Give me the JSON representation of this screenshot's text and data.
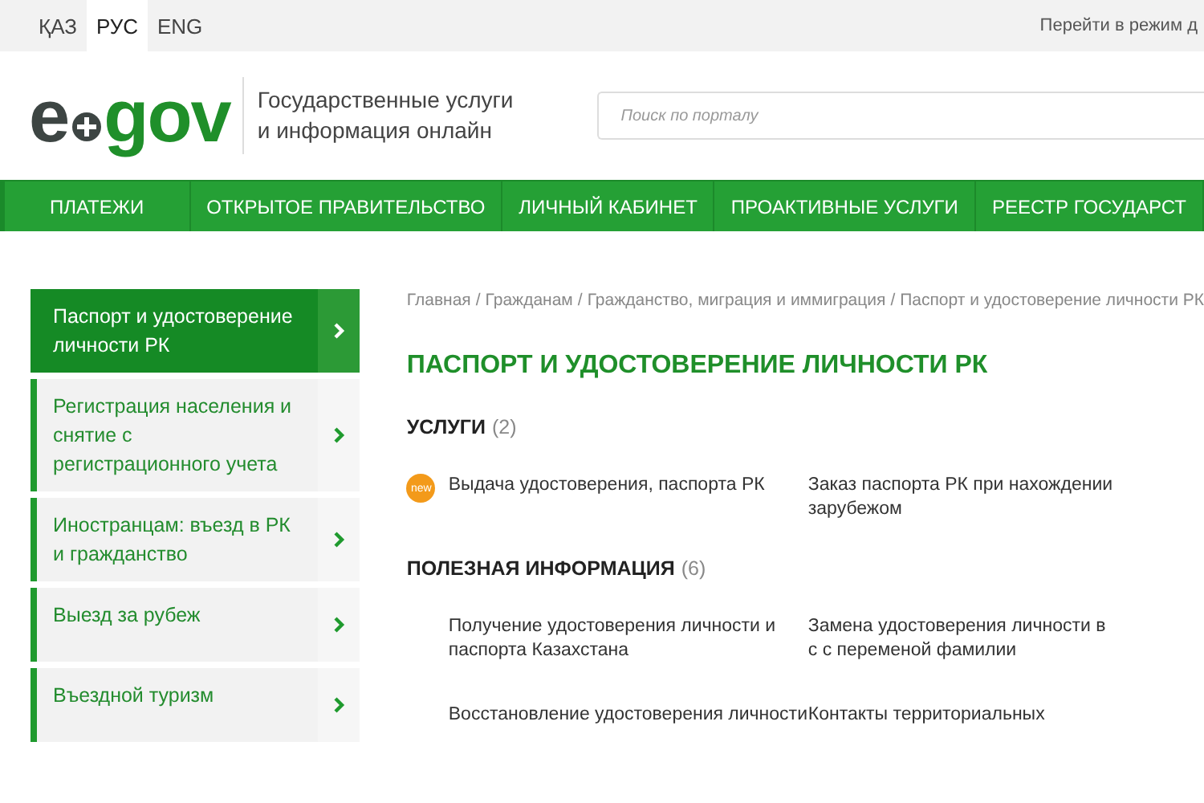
{
  "top_bar": {
    "languages": [
      {
        "label": "ҚАЗ",
        "selected": false
      },
      {
        "label": "РУС",
        "selected": true
      },
      {
        "label": "ENG",
        "selected": false
      }
    ],
    "right_link": "Перейти в режим д"
  },
  "header": {
    "logo": {
      "left": "e",
      "right": "gov"
    },
    "tagline": [
      "Государственные услуги",
      "и информация онлайн"
    ],
    "search": {
      "placeholder": "Поиск по порталу"
    }
  },
  "nav": [
    "ПЛАТЕЖИ",
    "ОТКРЫТОЕ ПРАВИТЕЛЬСТВО",
    "ЛИЧНЫЙ КАБИНЕТ",
    "ПРОАКТИВНЫЕ УСЛУГИ",
    "РЕЕСТР ГОСУДАРСТ"
  ],
  "sidebar": {
    "items": [
      {
        "label": "Паспорт и удостоверение личности РК",
        "selected": true
      },
      {
        "label": "Регистрация населения и снятие с регистрационного учета",
        "selected": false
      },
      {
        "label": "Иностранцам: въезд в РК и гражданство",
        "selected": false
      },
      {
        "label": "Выезд за рубеж",
        "selected": false
      },
      {
        "label": "Въездной туризм",
        "selected": false
      }
    ]
  },
  "breadcrumbs": [
    {
      "kind": "link",
      "text": "Главная"
    },
    {
      "kind": "separator",
      "text": "/"
    },
    {
      "kind": "link",
      "text": "Гражданам"
    },
    {
      "kind": "separator",
      "text": "/"
    },
    {
      "kind": "link",
      "text": "Гражданство, миграция и иммиграция"
    },
    {
      "kind": "separator",
      "text": "/"
    },
    {
      "kind": "link",
      "text": "Паспорт и удостоверение личности РК"
    }
  ],
  "title": "ПАСПОРТ И УДОСТОВЕРЕНИЕ ЛИЧНОСТИ РК",
  "sections": [
    {
      "heading": "УСЛУГИ",
      "count": "(2)",
      "items": [
        {
          "text": "Выдача удостоверения, паспорта РК",
          "badge": "new"
        },
        {
          "text": "Заказ паспорта РК при нахождении зарубежом"
        }
      ]
    },
    {
      "heading": "ПОЛЕЗНАЯ ИНФОРМАЦИЯ",
      "count": "(6)",
      "items": [
        {
          "text": "Получение удостоверения личности и паспорта Казахстана"
        },
        {
          "text": "Замена удостоверения личности в с с переменой фамилии"
        },
        {
          "text": "Восстановление удостоверения личности"
        },
        {
          "text": "Контакты территориальных"
        }
      ]
    }
  ]
}
